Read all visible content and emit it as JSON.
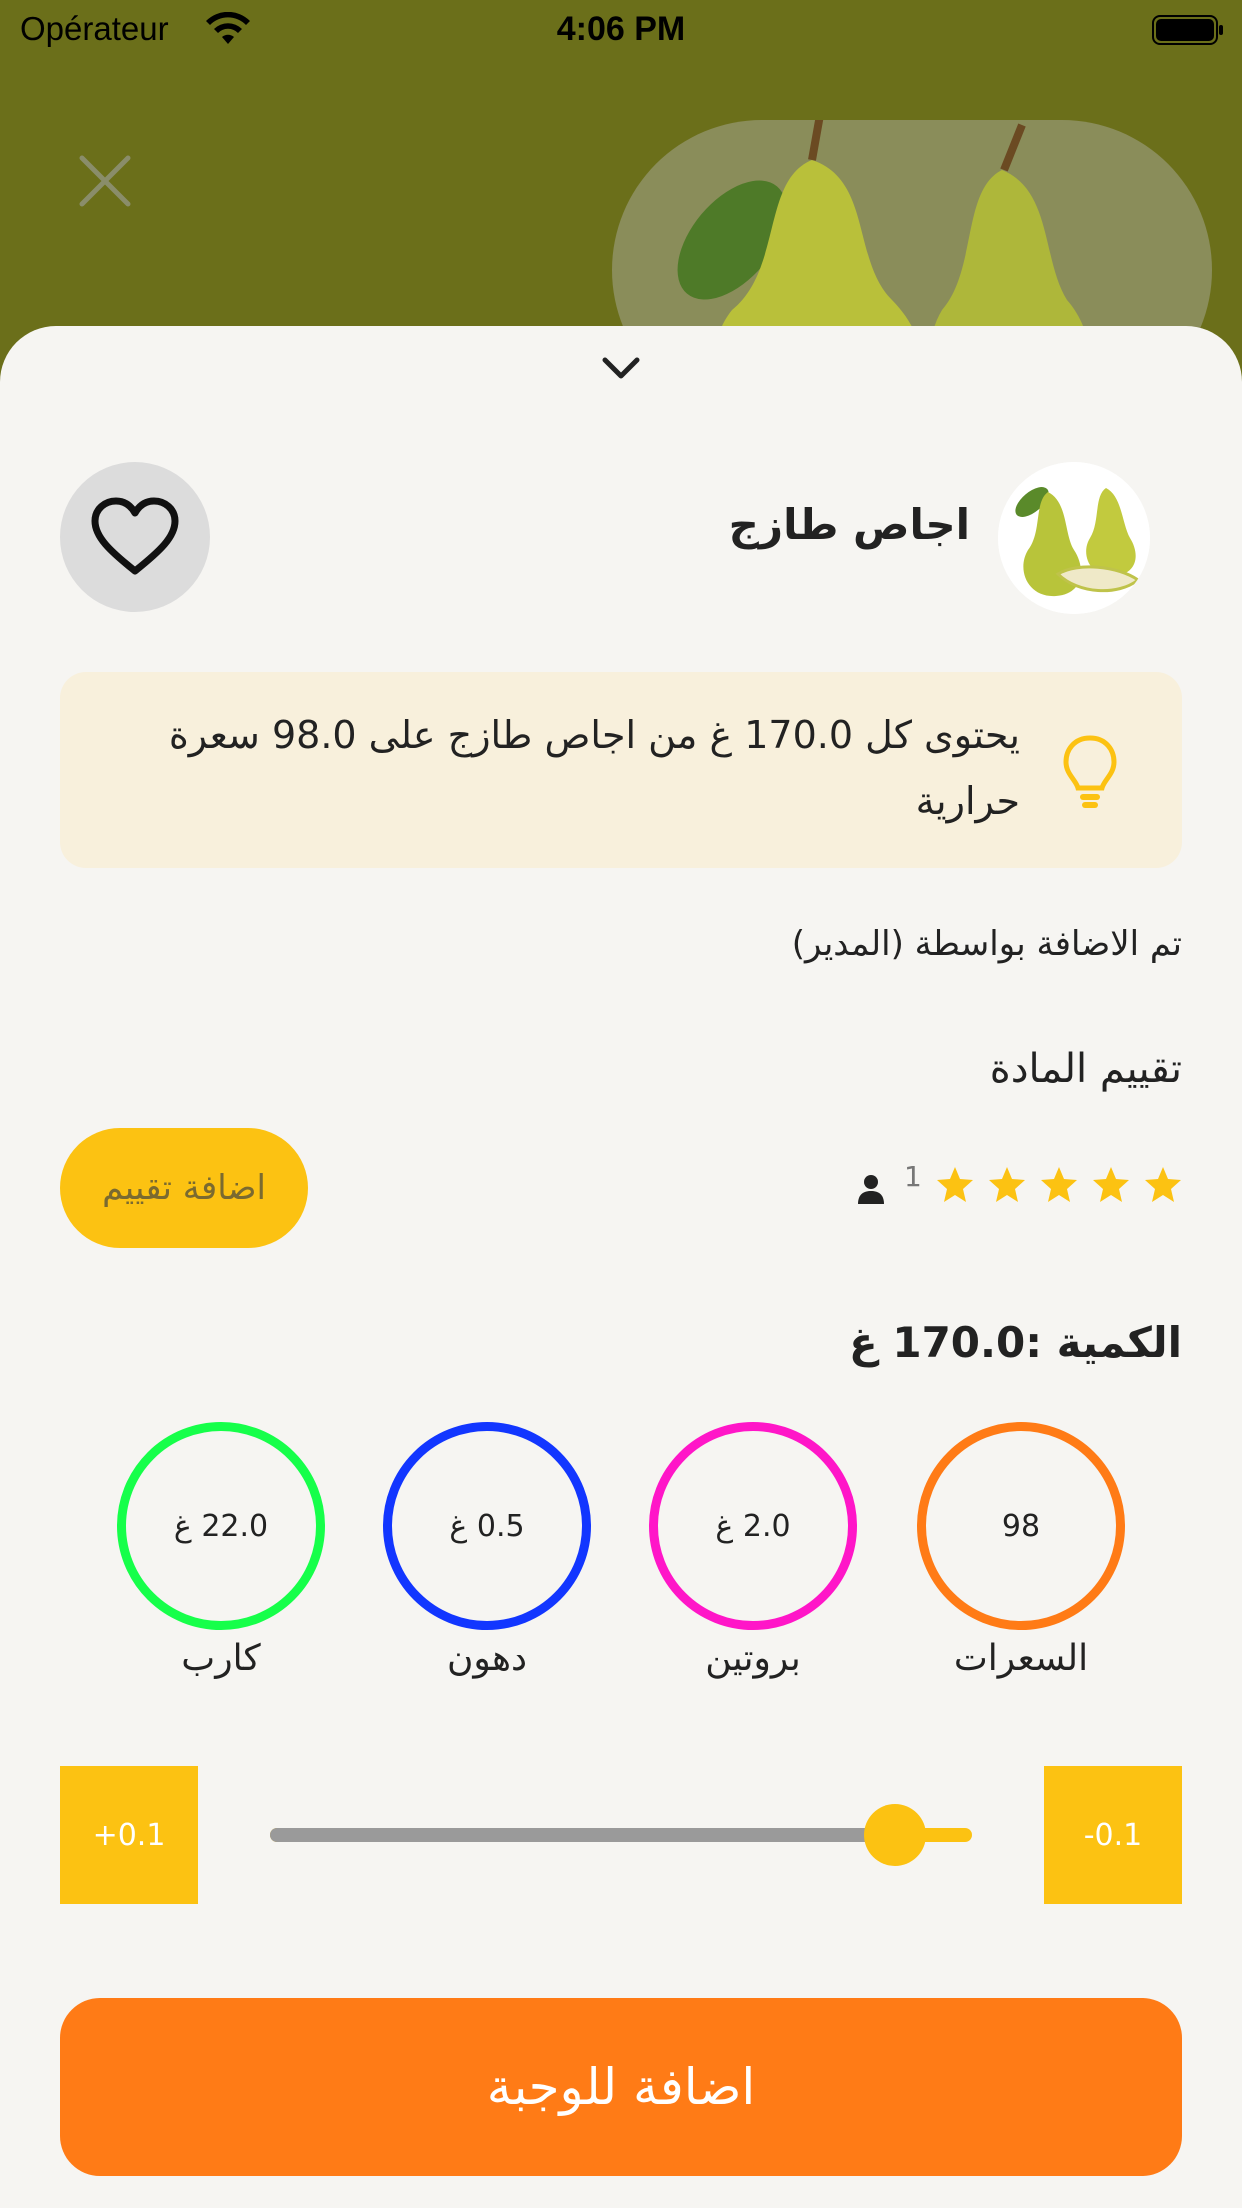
{
  "status_bar": {
    "carrier": "Opérateur",
    "time": "4:06 PM"
  },
  "product": {
    "name": "اجاص طازج",
    "info": "يحتوى كل 170.0 غ من اجاص طازج على 98.0 سعرة حرارية",
    "added_by": "تم الاضافة بواسطة (المدير)"
  },
  "rating": {
    "title": "تقييم المادة",
    "stars": 5,
    "count": "1",
    "add_label": "اضافة تقييم"
  },
  "quantity_label": "الكمية :170.0 غ",
  "nutrients": [
    {
      "label": "السعرات",
      "value": "98",
      "color": "#ff7b16"
    },
    {
      "label": "بروتين",
      "value": "2.0 غ",
      "color": "#ff16c8"
    },
    {
      "label": "دهون",
      "value": "0.5 غ",
      "color": "#1236ff"
    },
    {
      "label": "كارب",
      "value": "22.0 غ",
      "color": "#16ff4a"
    }
  ],
  "stepper": {
    "minus_label": "-0.1",
    "plus_label": "+0.1",
    "slider_fraction": 0.11
  },
  "add_meal_label": "اضافة للوجبة",
  "colors": {
    "accent": "#fcc212",
    "primary": "#ff7b16",
    "header": "#6b6f1a",
    "sheet": "#f6f5f2"
  },
  "icons": [
    "wifi-icon",
    "battery-icon",
    "close-icon",
    "chevron-down-icon",
    "heart-icon",
    "bulb-icon",
    "star-icon",
    "person-icon"
  ]
}
